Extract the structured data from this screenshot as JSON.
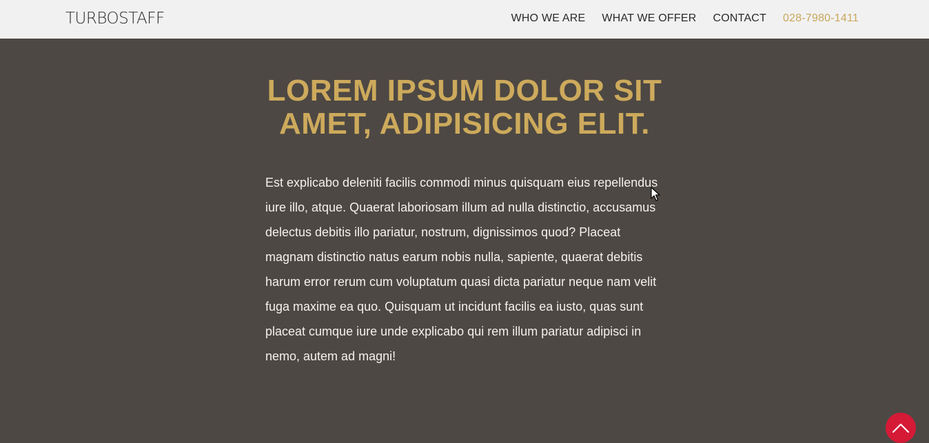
{
  "navbar": {
    "brand": "TURBOSTAFF",
    "links": [
      {
        "label": "WHO WE ARE"
      },
      {
        "label": "WHAT WE OFFER"
      },
      {
        "label": "CONTACT"
      }
    ],
    "phone": "028-7980-1411"
  },
  "hero": {
    "title": "LOREM IPSUM DOLOR SIT AMET, ADIPISICING ELIT.",
    "body": "Est explicabo deleniti facilis commodi minus quisquam eius repellendus iure illo, atque. Quaerat laboriosam illum ad nulla distinctio, accusamus delectus debitis illo pariatur, nostrum, dignissimos quod? Placeat magnam distinctio natus earum nobis nulla, sapiente, quaerat debitis harum error rerum cum voluptatum quasi dicta pariatur neque nam velit fuga maxime ea quo. Quisquam ut incidunt facilis ea iusto, quas sunt placeat cumque iure unde explicabo qui rem illum pariatur adipisci in nemo, autem ad magni!"
  },
  "icons": {
    "scroll_top": "chevron-up-icon",
    "cursor": "mouse-pointer-icon"
  },
  "colors": {
    "navbar_bg": "#f1f1f1",
    "page_bg": "#4d4844",
    "accent_gold": "#cdaa5c",
    "scroll_button": "#d51a36",
    "body_text": "#f4f1ec"
  }
}
